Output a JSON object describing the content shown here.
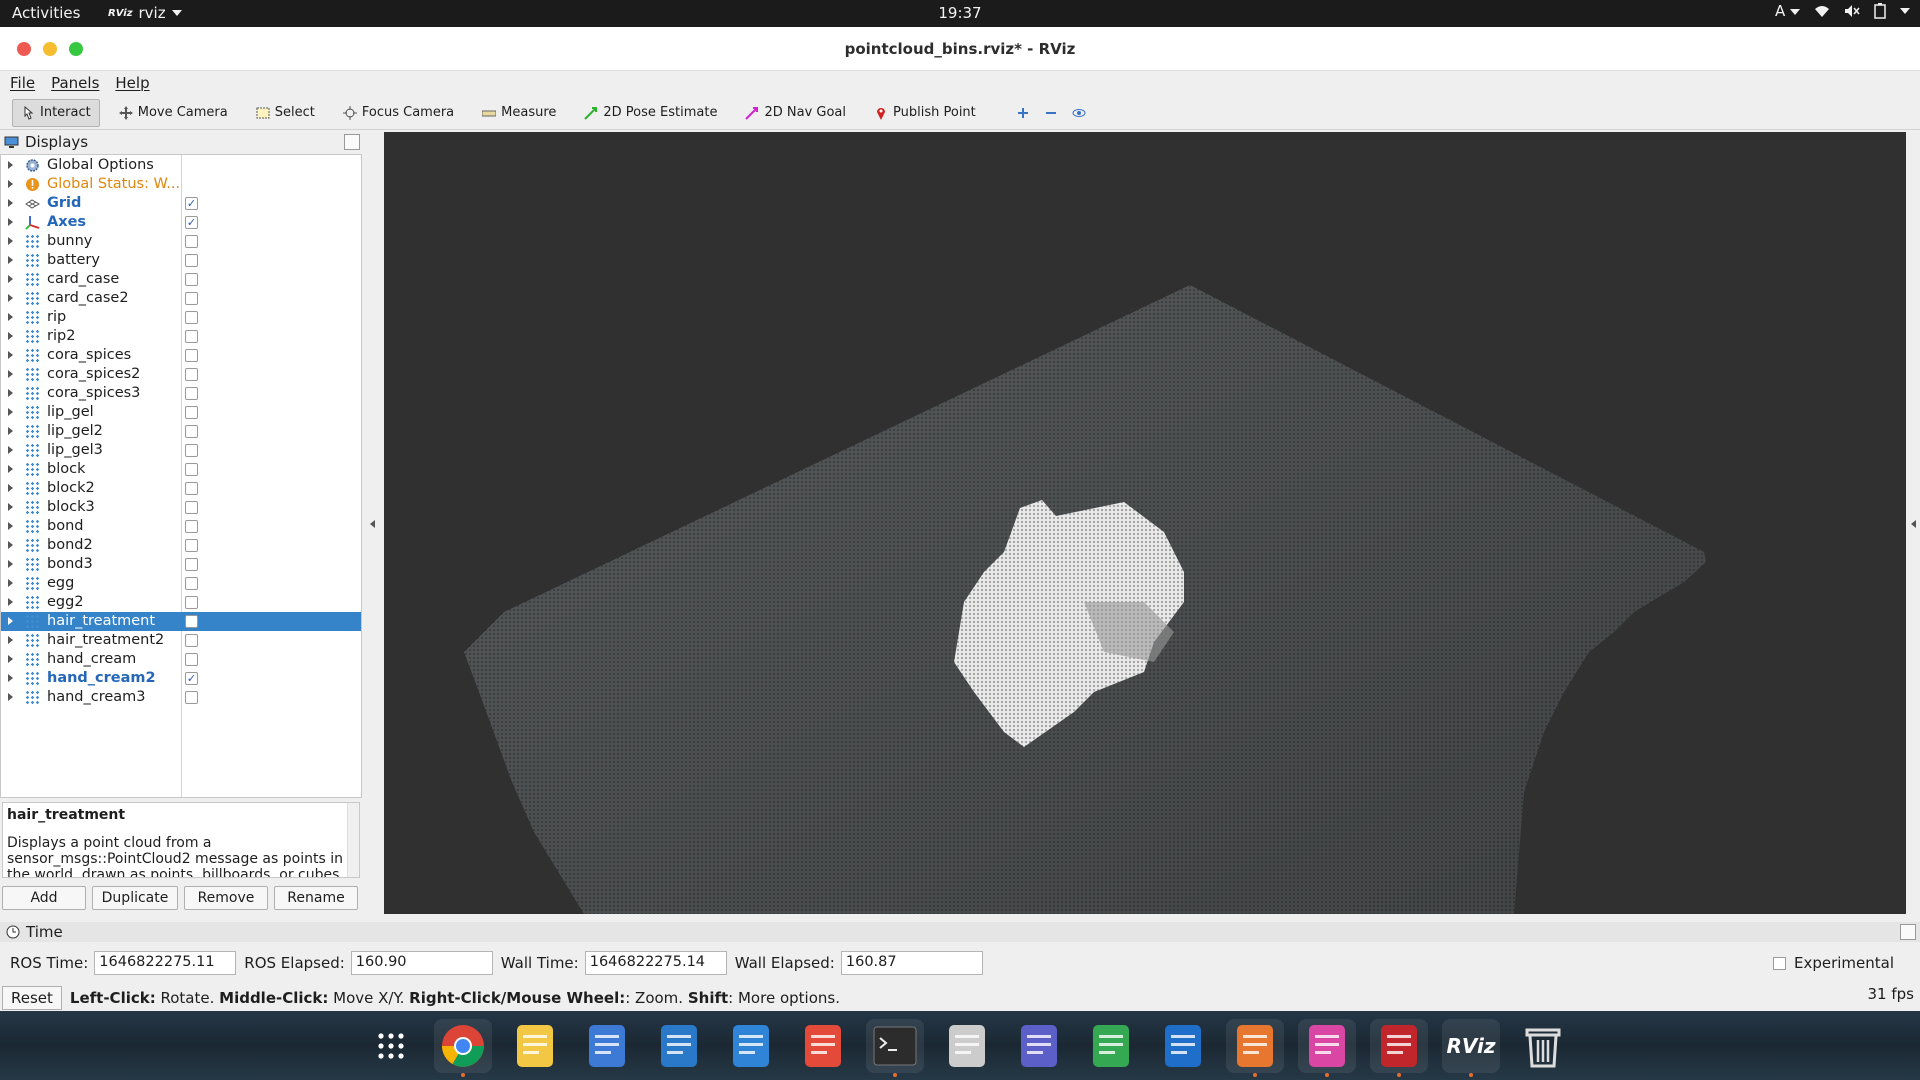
{
  "topbar": {
    "activities": "Activities",
    "app_name": "rviz",
    "app_icon_text": "RViz",
    "clock": "19:37",
    "input_method": "A"
  },
  "window": {
    "title": "pointcloud_bins.rviz* - RViz"
  },
  "menu": {
    "items": [
      "File",
      "Panels",
      "Help"
    ]
  },
  "toolbar": {
    "tools": [
      {
        "label": "Interact",
        "icon": "interact-icon",
        "active": true
      },
      {
        "label": "Move Camera",
        "icon": "move-camera-icon"
      },
      {
        "label": "Select",
        "icon": "select-icon"
      },
      {
        "label": "Focus Camera",
        "icon": "focus-camera-icon"
      },
      {
        "label": "Measure",
        "icon": "measure-icon"
      },
      {
        "label": "2D Pose Estimate",
        "icon": "pose-estimate-icon",
        "color": "#2db22d"
      },
      {
        "label": "2D Nav Goal",
        "icon": "nav-goal-icon",
        "color": "#d022d0"
      },
      {
        "label": "Publish Point",
        "icon": "publish-point-icon",
        "color": "#d02222"
      }
    ]
  },
  "displays": {
    "title": "Displays",
    "items": [
      {
        "label": "Global Options",
        "icon": "gear-icon",
        "checkbox": false,
        "style": "normal"
      },
      {
        "label": "Global Status: W...",
        "icon": "warning-icon",
        "checkbox": false,
        "style": "orange"
      },
      {
        "label": "Grid",
        "icon": "grid-icon",
        "checkbox": true,
        "checked": true,
        "style": "blue"
      },
      {
        "label": "Axes",
        "icon": "axes-icon",
        "checkbox": true,
        "checked": true,
        "style": "blue"
      },
      {
        "label": "bunny",
        "icon": "pointcloud-icon",
        "checkbox": true,
        "checked": false
      },
      {
        "label": "battery",
        "icon": "pointcloud-icon",
        "checkbox": true,
        "checked": false
      },
      {
        "label": "card_case",
        "icon": "pointcloud-icon",
        "checkbox": true,
        "checked": false
      },
      {
        "label": "card_case2",
        "icon": "pointcloud-icon",
        "checkbox": true,
        "checked": false
      },
      {
        "label": "rip",
        "icon": "pointcloud-icon",
        "checkbox": true,
        "checked": false
      },
      {
        "label": "rip2",
        "icon": "pointcloud-icon",
        "checkbox": true,
        "checked": false
      },
      {
        "label": "cora_spices",
        "icon": "pointcloud-icon",
        "checkbox": true,
        "checked": false
      },
      {
        "label": "cora_spices2",
        "icon": "pointcloud-icon",
        "checkbox": true,
        "checked": false
      },
      {
        "label": "cora_spices3",
        "icon": "pointcloud-icon",
        "checkbox": true,
        "checked": false
      },
      {
        "label": "lip_gel",
        "icon": "pointcloud-icon",
        "checkbox": true,
        "checked": false
      },
      {
        "label": "lip_gel2",
        "icon": "pointcloud-icon",
        "checkbox": true,
        "checked": false
      },
      {
        "label": "lip_gel3",
        "icon": "pointcloud-icon",
        "checkbox": true,
        "checked": false
      },
      {
        "label": "block",
        "icon": "pointcloud-icon",
        "checkbox": true,
        "checked": false
      },
      {
        "label": "block2",
        "icon": "pointcloud-icon",
        "checkbox": true,
        "checked": false
      },
      {
        "label": "block3",
        "icon": "pointcloud-icon",
        "checkbox": true,
        "checked": false
      },
      {
        "label": "bond",
        "icon": "pointcloud-icon",
        "checkbox": true,
        "checked": false
      },
      {
        "label": "bond2",
        "icon": "pointcloud-icon",
        "checkbox": true,
        "checked": false
      },
      {
        "label": "bond3",
        "icon": "pointcloud-icon",
        "checkbox": true,
        "checked": false
      },
      {
        "label": "egg",
        "icon": "pointcloud-icon",
        "checkbox": true,
        "checked": false
      },
      {
        "label": "egg2",
        "icon": "pointcloud-icon",
        "checkbox": true,
        "checked": false
      },
      {
        "label": "hair_treatment",
        "icon": "pointcloud-icon",
        "checkbox": true,
        "checked": false,
        "selected": true
      },
      {
        "label": "hair_treatment2",
        "icon": "pointcloud-icon",
        "checkbox": true,
        "checked": false
      },
      {
        "label": "hand_cream",
        "icon": "pointcloud-icon",
        "checkbox": true,
        "checked": false
      },
      {
        "label": "hand_cream2",
        "icon": "pointcloud-icon",
        "checkbox": true,
        "checked": true,
        "style": "blue"
      },
      {
        "label": "hand_cream3",
        "icon": "pointcloud-icon",
        "checkbox": true,
        "checked": false
      }
    ],
    "description_title": "hair_treatment",
    "description_text": "Displays a point cloud from a sensor_msgs::PointCloud2 message as points in the world, drawn as points, billboards, or cubes.",
    "buttons": [
      "Add",
      "Duplicate",
      "Remove",
      "Rename"
    ]
  },
  "time": {
    "title": "Time",
    "ros_time_label": "ROS Time:",
    "ros_time": "1646822275.11",
    "ros_elapsed_label": "ROS Elapsed:",
    "ros_elapsed": "160.90",
    "wall_time_label": "Wall Time:",
    "wall_time": "1646822275.14",
    "wall_elapsed_label": "Wall Elapsed:",
    "wall_elapsed": "160.87",
    "experimental_label": "Experimental"
  },
  "status": {
    "reset_label": "Reset",
    "hint_parts": [
      {
        "b": "Left-Click:",
        "t": " Rotate. "
      },
      {
        "b": "Middle-Click:",
        "t": " Move X/Y. "
      },
      {
        "b": "Right-Click/Mouse Wheel:",
        "t": ": Zoom. "
      },
      {
        "b": "Shift",
        "t": ": More options."
      }
    ],
    "fps": "31 fps"
  },
  "dock": {
    "apps": [
      {
        "name": "show-apps-icon",
        "color": "#ffffff"
      },
      {
        "name": "chrome-icon",
        "color": "#db4437",
        "running": true
      },
      {
        "name": "rhythmbox-icon",
        "color": "#f2c744"
      },
      {
        "name": "files-icon",
        "color": "#3d7ad6"
      },
      {
        "name": "writer-icon",
        "color": "#2a79c9"
      },
      {
        "name": "settings-app-icon",
        "color": "#2f84d8"
      },
      {
        "name": "help-icon",
        "color": "#e34a3a"
      },
      {
        "name": "terminal-icon",
        "color": "#2c2c2c",
        "running": true
      },
      {
        "name": "inkscape-icon",
        "color": "#cccccc"
      },
      {
        "name": "teams-icon",
        "color": "#5b5fc7"
      },
      {
        "name": "calc-icon",
        "color": "#34a853"
      },
      {
        "name": "thunderbird-icon",
        "color": "#1f6ec9"
      },
      {
        "name": "impress-icon",
        "color": "#e7772f",
        "running": true
      },
      {
        "name": "image-viewer-icon",
        "color": "#d946a4",
        "running": true
      },
      {
        "name": "screen-recorder-icon",
        "color": "#c0262c",
        "running": true
      },
      {
        "name": "rviz-icon",
        "color": "#cccccc",
        "running": true,
        "text": "RViz"
      },
      {
        "name": "trash-icon",
        "color": "#dddddd"
      }
    ]
  }
}
